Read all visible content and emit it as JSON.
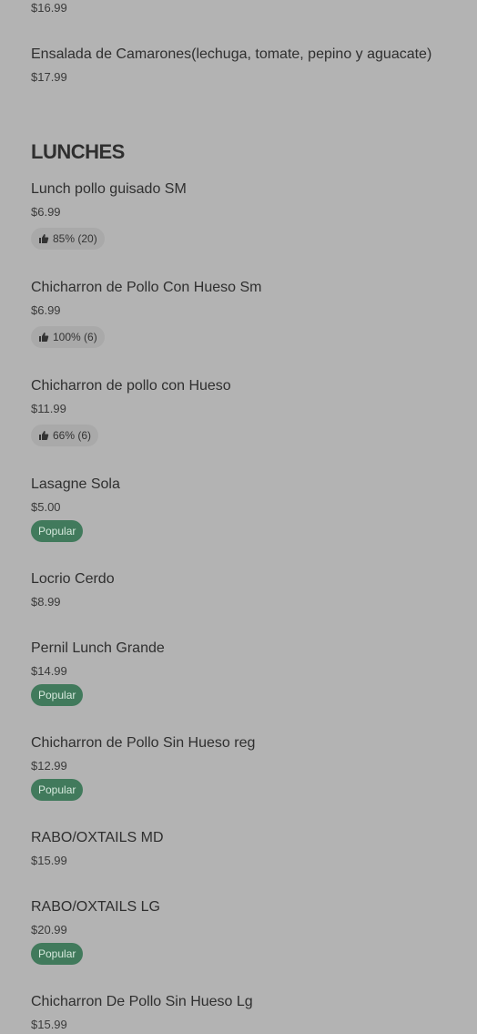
{
  "previous_section": {
    "items": [
      {
        "price": "$16.99"
      },
      {
        "name": "Ensalada de Camarones(lechuga, tomate, pepino y aguacate)",
        "price": "$17.99"
      }
    ]
  },
  "lunches": {
    "title": "LUNCHES",
    "items": [
      {
        "name": "Lunch pollo guisado SM",
        "price": "$6.99",
        "rating": "85% (20)"
      },
      {
        "name": "Chicharron de Pollo Con Hueso Sm",
        "price": "$6.99",
        "rating": "100% (6)"
      },
      {
        "name": "Chicharron de pollo con Hueso",
        "price": "$11.99",
        "rating": "66% (6)"
      },
      {
        "name": "Lasagne Sola",
        "price": "$5.00",
        "badge": "Popular"
      },
      {
        "name": "Locrio Cerdo",
        "price": "$8.99"
      },
      {
        "name": "Pernil Lunch Grande",
        "price": "$14.99",
        "badge": "Popular"
      },
      {
        "name": "Chicharron de Pollo Sin Hueso reg",
        "price": "$12.99",
        "badge": "Popular"
      },
      {
        "name": "RABO/OXTAILS MD",
        "price": "$15.99"
      },
      {
        "name": "RABO/OXTAILS LG",
        "price": "$20.99",
        "badge": "Popular"
      },
      {
        "name": "Chicharron De Pollo Sin Hueso Lg",
        "price": "$15.99"
      }
    ]
  },
  "icons": {
    "rating": "thumbs-up-icon"
  },
  "colors": {
    "background": "#b3b3b3",
    "popular_badge": "#417a5c",
    "rating_badge": "#a9a9a9"
  }
}
